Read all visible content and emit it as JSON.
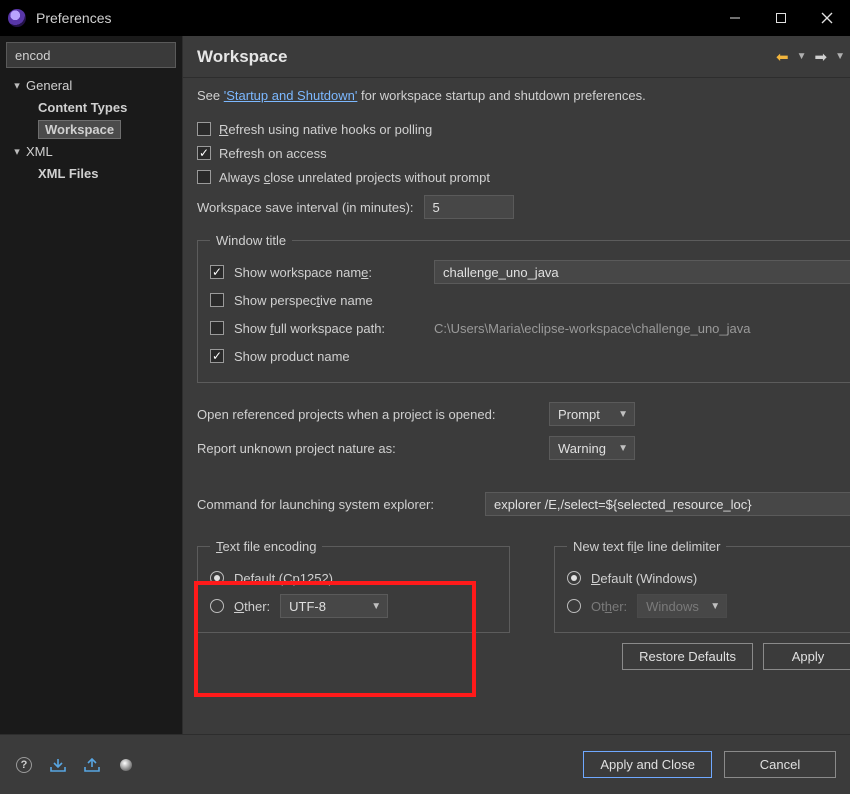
{
  "window": {
    "title": "Preferences"
  },
  "sidebar": {
    "filter_value": "encod",
    "nodes": [
      {
        "label": "General",
        "children": [
          {
            "label": "Content Types"
          },
          {
            "label": "Workspace",
            "selected": true
          }
        ]
      },
      {
        "label": "XML",
        "children": [
          {
            "label": "XML Files"
          }
        ]
      }
    ]
  },
  "page": {
    "title": "Workspace",
    "intro_prefix": "See ",
    "intro_link": "'Startup and Shutdown'",
    "intro_suffix": " for workspace startup and shutdown preferences.",
    "refresh_native": {
      "label_pre": "R",
      "label_mid": "efresh using native hooks or polling",
      "checked": false
    },
    "refresh_access": {
      "label": "Refresh on access",
      "checked": true
    },
    "close_unrelated": {
      "label_pre": "Always ",
      "label_u": "c",
      "label_post": "lose unrelated projects without prompt",
      "checked": false
    },
    "save_interval": {
      "label": "Workspace save interval (in minutes):",
      "value": "5"
    },
    "window_title": {
      "legend": "Window title",
      "show_workspace_name": {
        "label_pre": "Show workspace nam",
        "label_u": "e",
        "label_post": ":",
        "checked": true,
        "value": "challenge_uno_java"
      },
      "show_perspective": {
        "label_pre": "Show perspec",
        "label_u": "t",
        "label_post": "ive name",
        "checked": false
      },
      "show_full_path": {
        "label_pre": "Show ",
        "label_u": "f",
        "label_post": "ull workspace path:",
        "checked": false,
        "path": "C:\\Users\\Maria\\eclipse-workspace\\challenge_uno_java"
      },
      "show_product": {
        "label": "Show product name",
        "checked": true
      }
    },
    "open_referenced": {
      "label": "Open referenced projects when a project is opened:",
      "value": "Prompt"
    },
    "report_unknown": {
      "label": "Report unknown project nature as:",
      "value": "Warning"
    },
    "explorer_cmd": {
      "label": "Command for launching system explorer:",
      "value": "explorer /E,/select=${selected_resource_loc}"
    },
    "encoding": {
      "legend_pre": "T",
      "legend_post": "ext file encoding",
      "default_label": "Default (Cp1252)",
      "other_label_pre": "O",
      "other_label_post": "ther:",
      "other_value": "UTF-8",
      "selected": "default"
    },
    "delimiter": {
      "legend_pre": "New text fi",
      "legend_u": "l",
      "legend_post": "e line delimiter",
      "default_label_pre": "D",
      "default_label_post": "efault (Windows)",
      "other_label_pre": "Ot",
      "other_label_u": "h",
      "other_label_post": "er:",
      "other_value": "Windows",
      "selected": "default"
    },
    "buttons": {
      "restore": "Restore Defaults",
      "apply": "Apply",
      "apply_close": "Apply and Close",
      "cancel": "Cancel"
    }
  }
}
